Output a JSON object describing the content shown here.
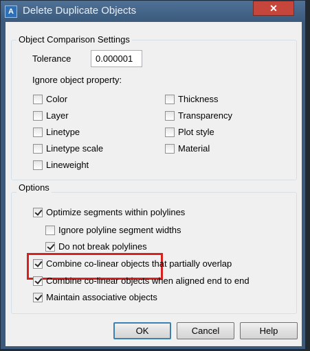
{
  "window": {
    "title": "Delete Duplicate Objects",
    "app_icon_text": "A",
    "close_glyph": "✕"
  },
  "comparison": {
    "group_title": "Object Comparison Settings",
    "tolerance_label": "Tolerance",
    "tolerance_value": "0.000001",
    "ignore_label": "Ignore object property:",
    "left_props": [
      {
        "label": "Color",
        "checked": false
      },
      {
        "label": "Layer",
        "checked": false
      },
      {
        "label": "Linetype",
        "checked": false
      },
      {
        "label": "Linetype scale",
        "checked": false
      },
      {
        "label": "Lineweight",
        "checked": false
      }
    ],
    "right_props": [
      {
        "label": "Thickness",
        "checked": false
      },
      {
        "label": "Transparency",
        "checked": false
      },
      {
        "label": "Plot style",
        "checked": false
      },
      {
        "label": "Material",
        "checked": false
      }
    ]
  },
  "options": {
    "group_title": "Options",
    "items": [
      {
        "label": "Optimize segments within polylines",
        "checked": true
      },
      {
        "label": "Ignore polyline segment widths",
        "checked": false
      },
      {
        "label": "Do not break polylines",
        "checked": true
      },
      {
        "label": "Combine co-linear objects that partially overlap",
        "checked": true
      },
      {
        "label": "Combine co-linear objects when aligned end to end",
        "checked": true
      },
      {
        "label": "Maintain associative objects",
        "checked": true
      }
    ]
  },
  "buttons": {
    "ok": "OK",
    "cancel": "Cancel",
    "help": "Help"
  },
  "colors": {
    "highlight": "#d8201d",
    "title_bar": "#3b5a7c",
    "close_button": "#c7463c"
  }
}
